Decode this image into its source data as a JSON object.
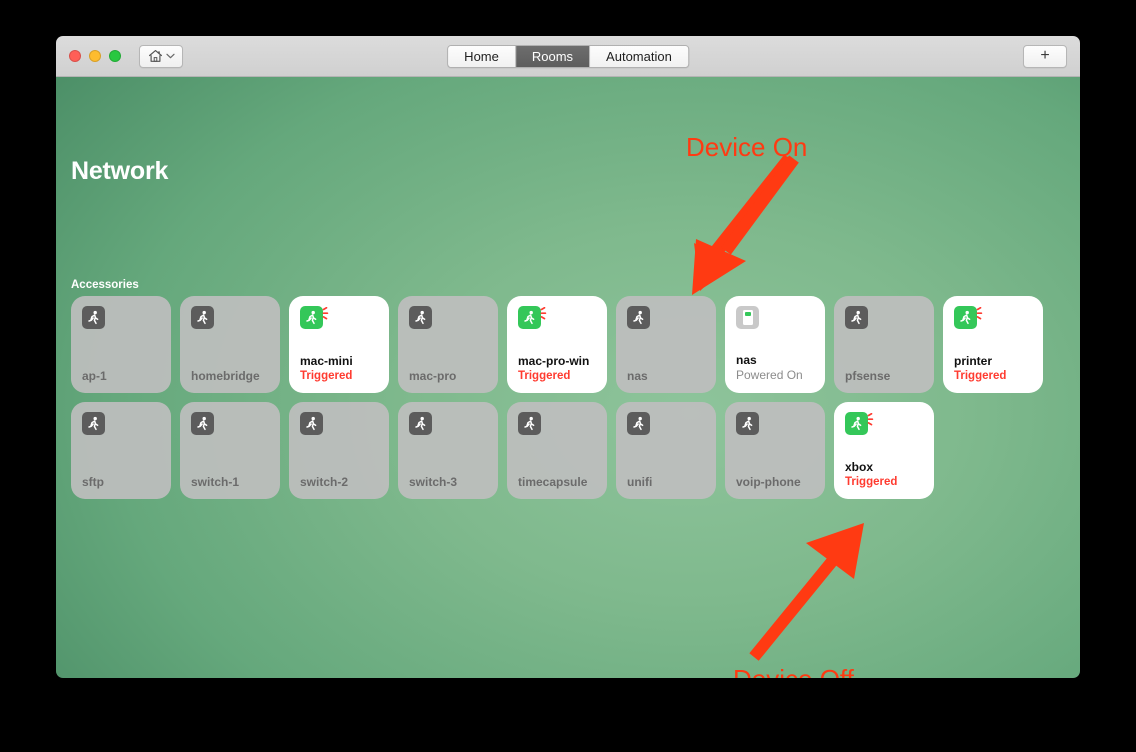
{
  "window": {
    "traffic_lights": [
      "close",
      "minimize",
      "maximize"
    ],
    "home_button_icon": "house-icon",
    "home_button_chevron_icon": "chevron-down-icon",
    "add_button_label": "+",
    "tabs": [
      {
        "label": "Home",
        "active": false
      },
      {
        "label": "Rooms",
        "active": true
      },
      {
        "label": "Automation",
        "active": false
      }
    ]
  },
  "room": {
    "title": "Network",
    "section_label": "Accessories"
  },
  "colors": {
    "accent_green": "#34c759",
    "triggered_red": "#ff3b30",
    "annotation_red": "#ff3a12",
    "tab_active_bg": "#5e5e5e",
    "tile_off_bg": "#bebebe",
    "tile_on_bg": "#ffffff",
    "wallpaper_light": "#8ec49b",
    "wallpaper_dark": "#4d9068"
  },
  "accessories": [
    {
      "name": "ap-1",
      "state": "",
      "on": false,
      "icon": "motion-sensor-icon"
    },
    {
      "name": "homebridge",
      "state": "",
      "on": false,
      "icon": "motion-sensor-icon"
    },
    {
      "name": "mac-mini",
      "state": "Triggered",
      "on": true,
      "icon": "motion-sensor-icon"
    },
    {
      "name": "mac-pro",
      "state": "",
      "on": false,
      "icon": "motion-sensor-icon"
    },
    {
      "name": "mac-pro-win",
      "state": "Triggered",
      "on": true,
      "icon": "motion-sensor-icon"
    },
    {
      "name": "nas",
      "state": "",
      "on": false,
      "icon": "motion-sensor-icon"
    },
    {
      "name": "nas",
      "state": "Powered On",
      "on": true,
      "icon": "outlet-icon"
    },
    {
      "name": "pfsense",
      "state": "",
      "on": false,
      "icon": "motion-sensor-icon"
    },
    {
      "name": "printer",
      "state": "Triggered",
      "on": true,
      "icon": "motion-sensor-icon"
    },
    {
      "name": "sftp",
      "state": "",
      "on": false,
      "icon": "motion-sensor-icon"
    },
    {
      "name": "switch-1",
      "state": "",
      "on": false,
      "icon": "motion-sensor-icon"
    },
    {
      "name": "switch-2",
      "state": "",
      "on": false,
      "icon": "motion-sensor-icon"
    },
    {
      "name": "switch-3",
      "state": "",
      "on": false,
      "icon": "motion-sensor-icon"
    },
    {
      "name": "timecapsule",
      "state": "",
      "on": false,
      "icon": "motion-sensor-icon"
    },
    {
      "name": "unifi",
      "state": "",
      "on": false,
      "icon": "motion-sensor-icon"
    },
    {
      "name": "voip-phone",
      "state": "",
      "on": false,
      "icon": "motion-sensor-icon"
    },
    {
      "name": "xbox",
      "state": "Triggered",
      "on": true,
      "icon": "motion-sensor-icon"
    }
  ],
  "annotations": {
    "device_on": "Device On",
    "device_off": "Device Off"
  }
}
